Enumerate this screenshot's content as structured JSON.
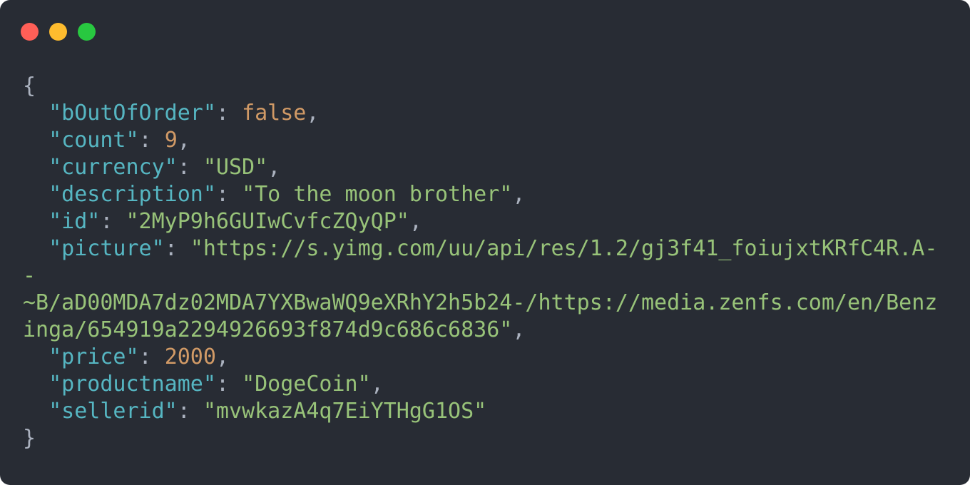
{
  "window": {
    "colors": {
      "background": "#282c34",
      "close": "#ff5f57",
      "minimize": "#febc2e",
      "maximize": "#28c840",
      "key": "#56b6c2",
      "string": "#98c379",
      "number": "#d19a66",
      "punctuation": "#abb2bf"
    }
  },
  "code": {
    "open_brace": "{",
    "close_brace": "}",
    "entries": {
      "bOutOfOrder": {
        "key": "\"bOutOfOrder\"",
        "value": "false"
      },
      "count": {
        "key": "\"count\"",
        "value": "9"
      },
      "currency": {
        "key": "\"currency\"",
        "value": "\"USD\""
      },
      "description": {
        "key": "\"description\"",
        "value": "\"To the moon brother\""
      },
      "id": {
        "key": "\"id\"",
        "value": "\"2MyP9h6GUIwCvfcZQyQP\""
      },
      "picture": {
        "key": "\"picture\"",
        "value_line1": "\"https://s.yimg.com/uu/api/res/1.2/gj3f41_foiujxtKRfC4R.A-",
        "value_line2": "-",
        "value_line3": "~B/aD00MDA7dz02MDA7YXBwaWQ9eXRhY2h5b24-/https://media.zenfs.com/en/Benz",
        "value_line4": "inga/654919a2294926693f874d9c686c6836\""
      },
      "price": {
        "key": "\"price\"",
        "value": "2000"
      },
      "productname": {
        "key": "\"productname\"",
        "value": "\"DogeCoin\""
      },
      "sellerid": {
        "key": "\"sellerid\"",
        "value": "\"mvwkazA4q7EiYTHgG1OS\""
      }
    }
  }
}
